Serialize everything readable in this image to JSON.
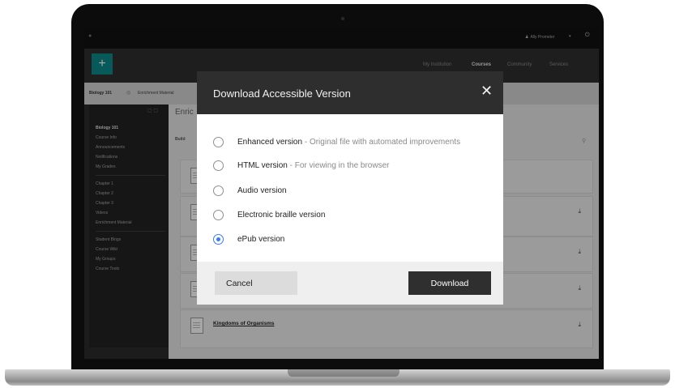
{
  "topbar": {
    "user_name": "Ally Prometer",
    "caret": "▾",
    "power": "⏻"
  },
  "navbar": {
    "logo_symbol": "+",
    "items": [
      "My Institution",
      "Courses",
      "Community",
      "Services"
    ],
    "active": "Courses"
  },
  "breadcrumb": {
    "course": "Biology 101",
    "current": "Enrichment Material"
  },
  "sidebar": {
    "tools": "▢ ▢",
    "items": [
      "Biology 101",
      "Course Info",
      "Announcements",
      "Notifications",
      "My Grades",
      "Chapter 1",
      "Chapter 2",
      "Chapter 3",
      "Videos",
      "Enrichment Material",
      "Student Blogs",
      "Course Wiki",
      "My Groups",
      "Course Tools"
    ]
  },
  "content": {
    "title": "Enric",
    "builder": "Build",
    "search_icon": "⚲",
    "card_last_title": "Kingdoms of Organisms",
    "download_icon": "⤓"
  },
  "modal": {
    "title": "Download Accessible Version",
    "close": "✕",
    "options": [
      {
        "label": "Enhanced version",
        "desc": " - Original file with automated improvements",
        "selected": false
      },
      {
        "label": "HTML version",
        "desc": " - For viewing in the browser",
        "selected": false
      },
      {
        "label": "Audio version",
        "desc": "",
        "selected": false
      },
      {
        "label": "Electronic braille version",
        "desc": "",
        "selected": false
      },
      {
        "label": "ePub version",
        "desc": "",
        "selected": true
      }
    ],
    "cancel": "Cancel",
    "download": "Download"
  },
  "colors": {
    "accent": "#0d8a8b",
    "radio_selected": "#3b7de0",
    "modal_header": "#2e2e2e",
    "download_button": "#2f2f2f"
  }
}
